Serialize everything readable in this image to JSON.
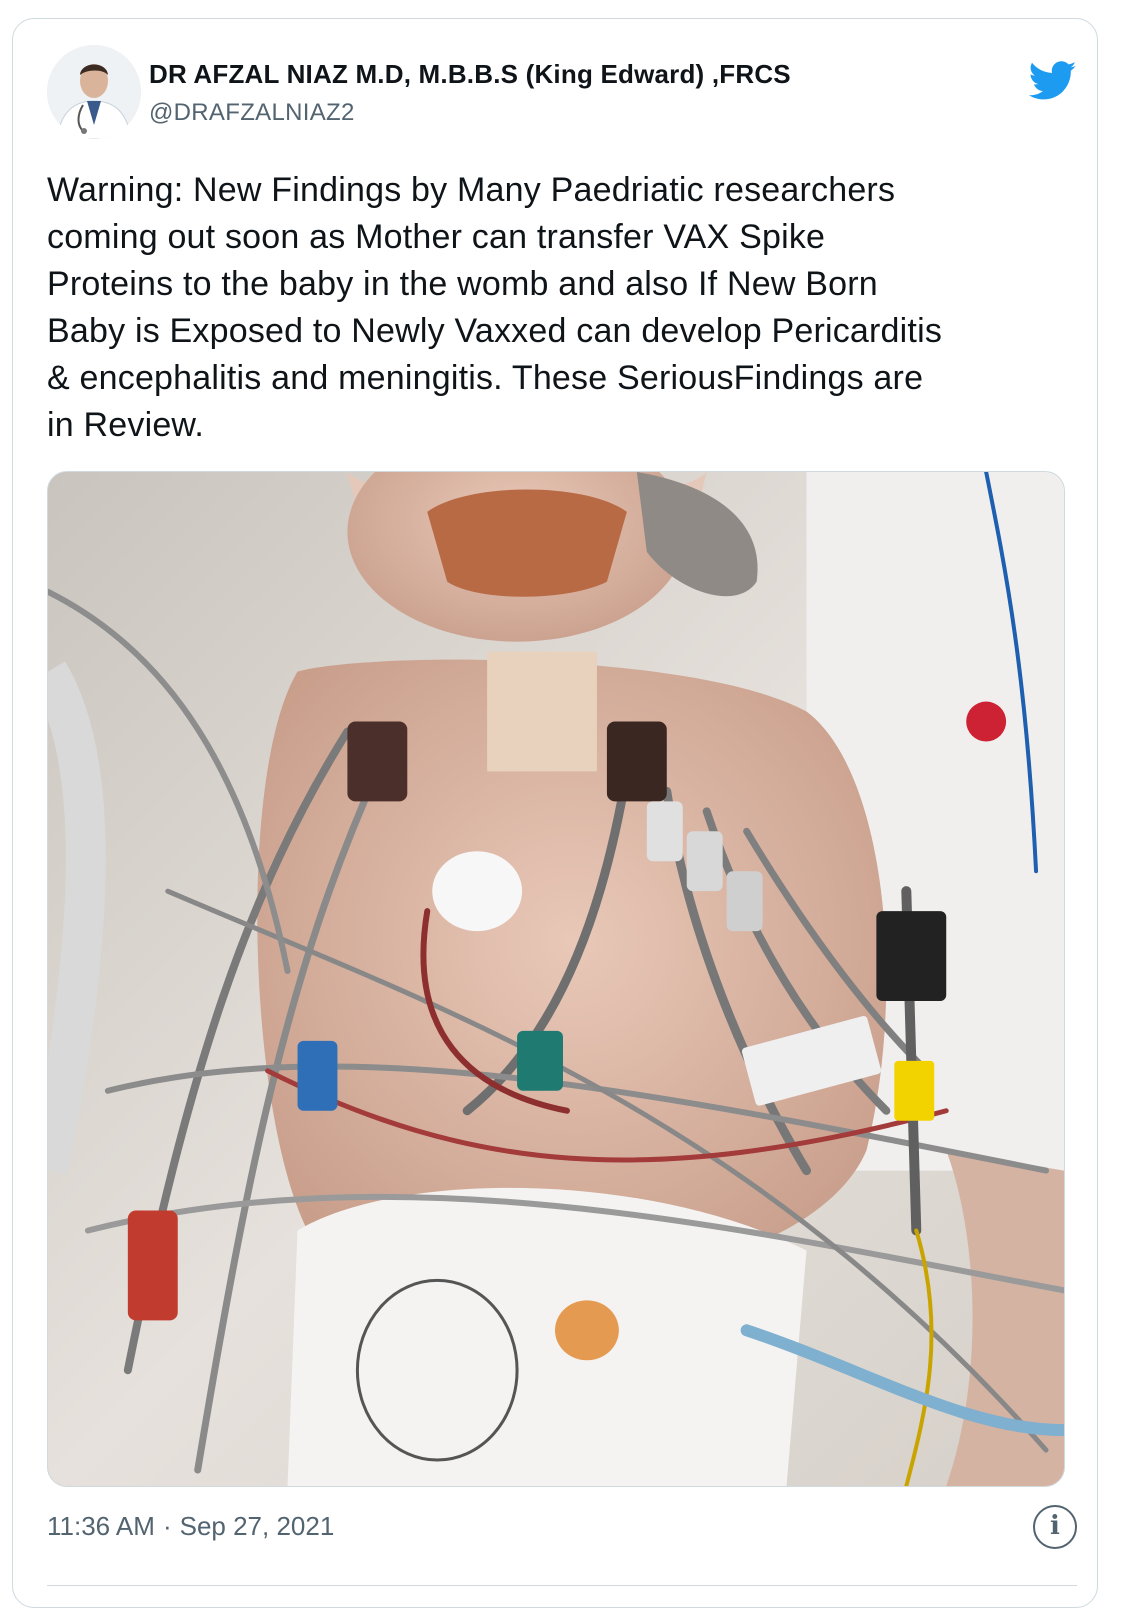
{
  "author": {
    "display_name": "DR AFZAL NIAZ M.D, M.B.B.S (King Edward) ,FRCS",
    "handle": "@DRAFZALNIAZ2",
    "avatar_icon": "doctor-avatar-icon"
  },
  "brand": {
    "logo_icon": "twitter-bird-icon",
    "color": "#1d9bf0"
  },
  "tweet": {
    "text_lines": [
      "Warning: New Findings by Many Paedriatic researchers",
      "coming out soon as Mother can transfer VAX Spike",
      "Proteins to the baby in the womb and also If New Born",
      "Baby is Exposed to Newly Vaxxed can develop Pericarditis",
      "& encephalitis and meningitis. These SeriousFindings are",
      "in Review."
    ],
    "media": {
      "description_icon": "photo-icon"
    }
  },
  "footer": {
    "time": "11:36 AM",
    "separator": "·",
    "date": "Sep 27, 2021",
    "info_icon": "info-icon"
  },
  "colors": {
    "text": "#0f1419",
    "secondary": "#536471",
    "border": "#cfd9de"
  }
}
